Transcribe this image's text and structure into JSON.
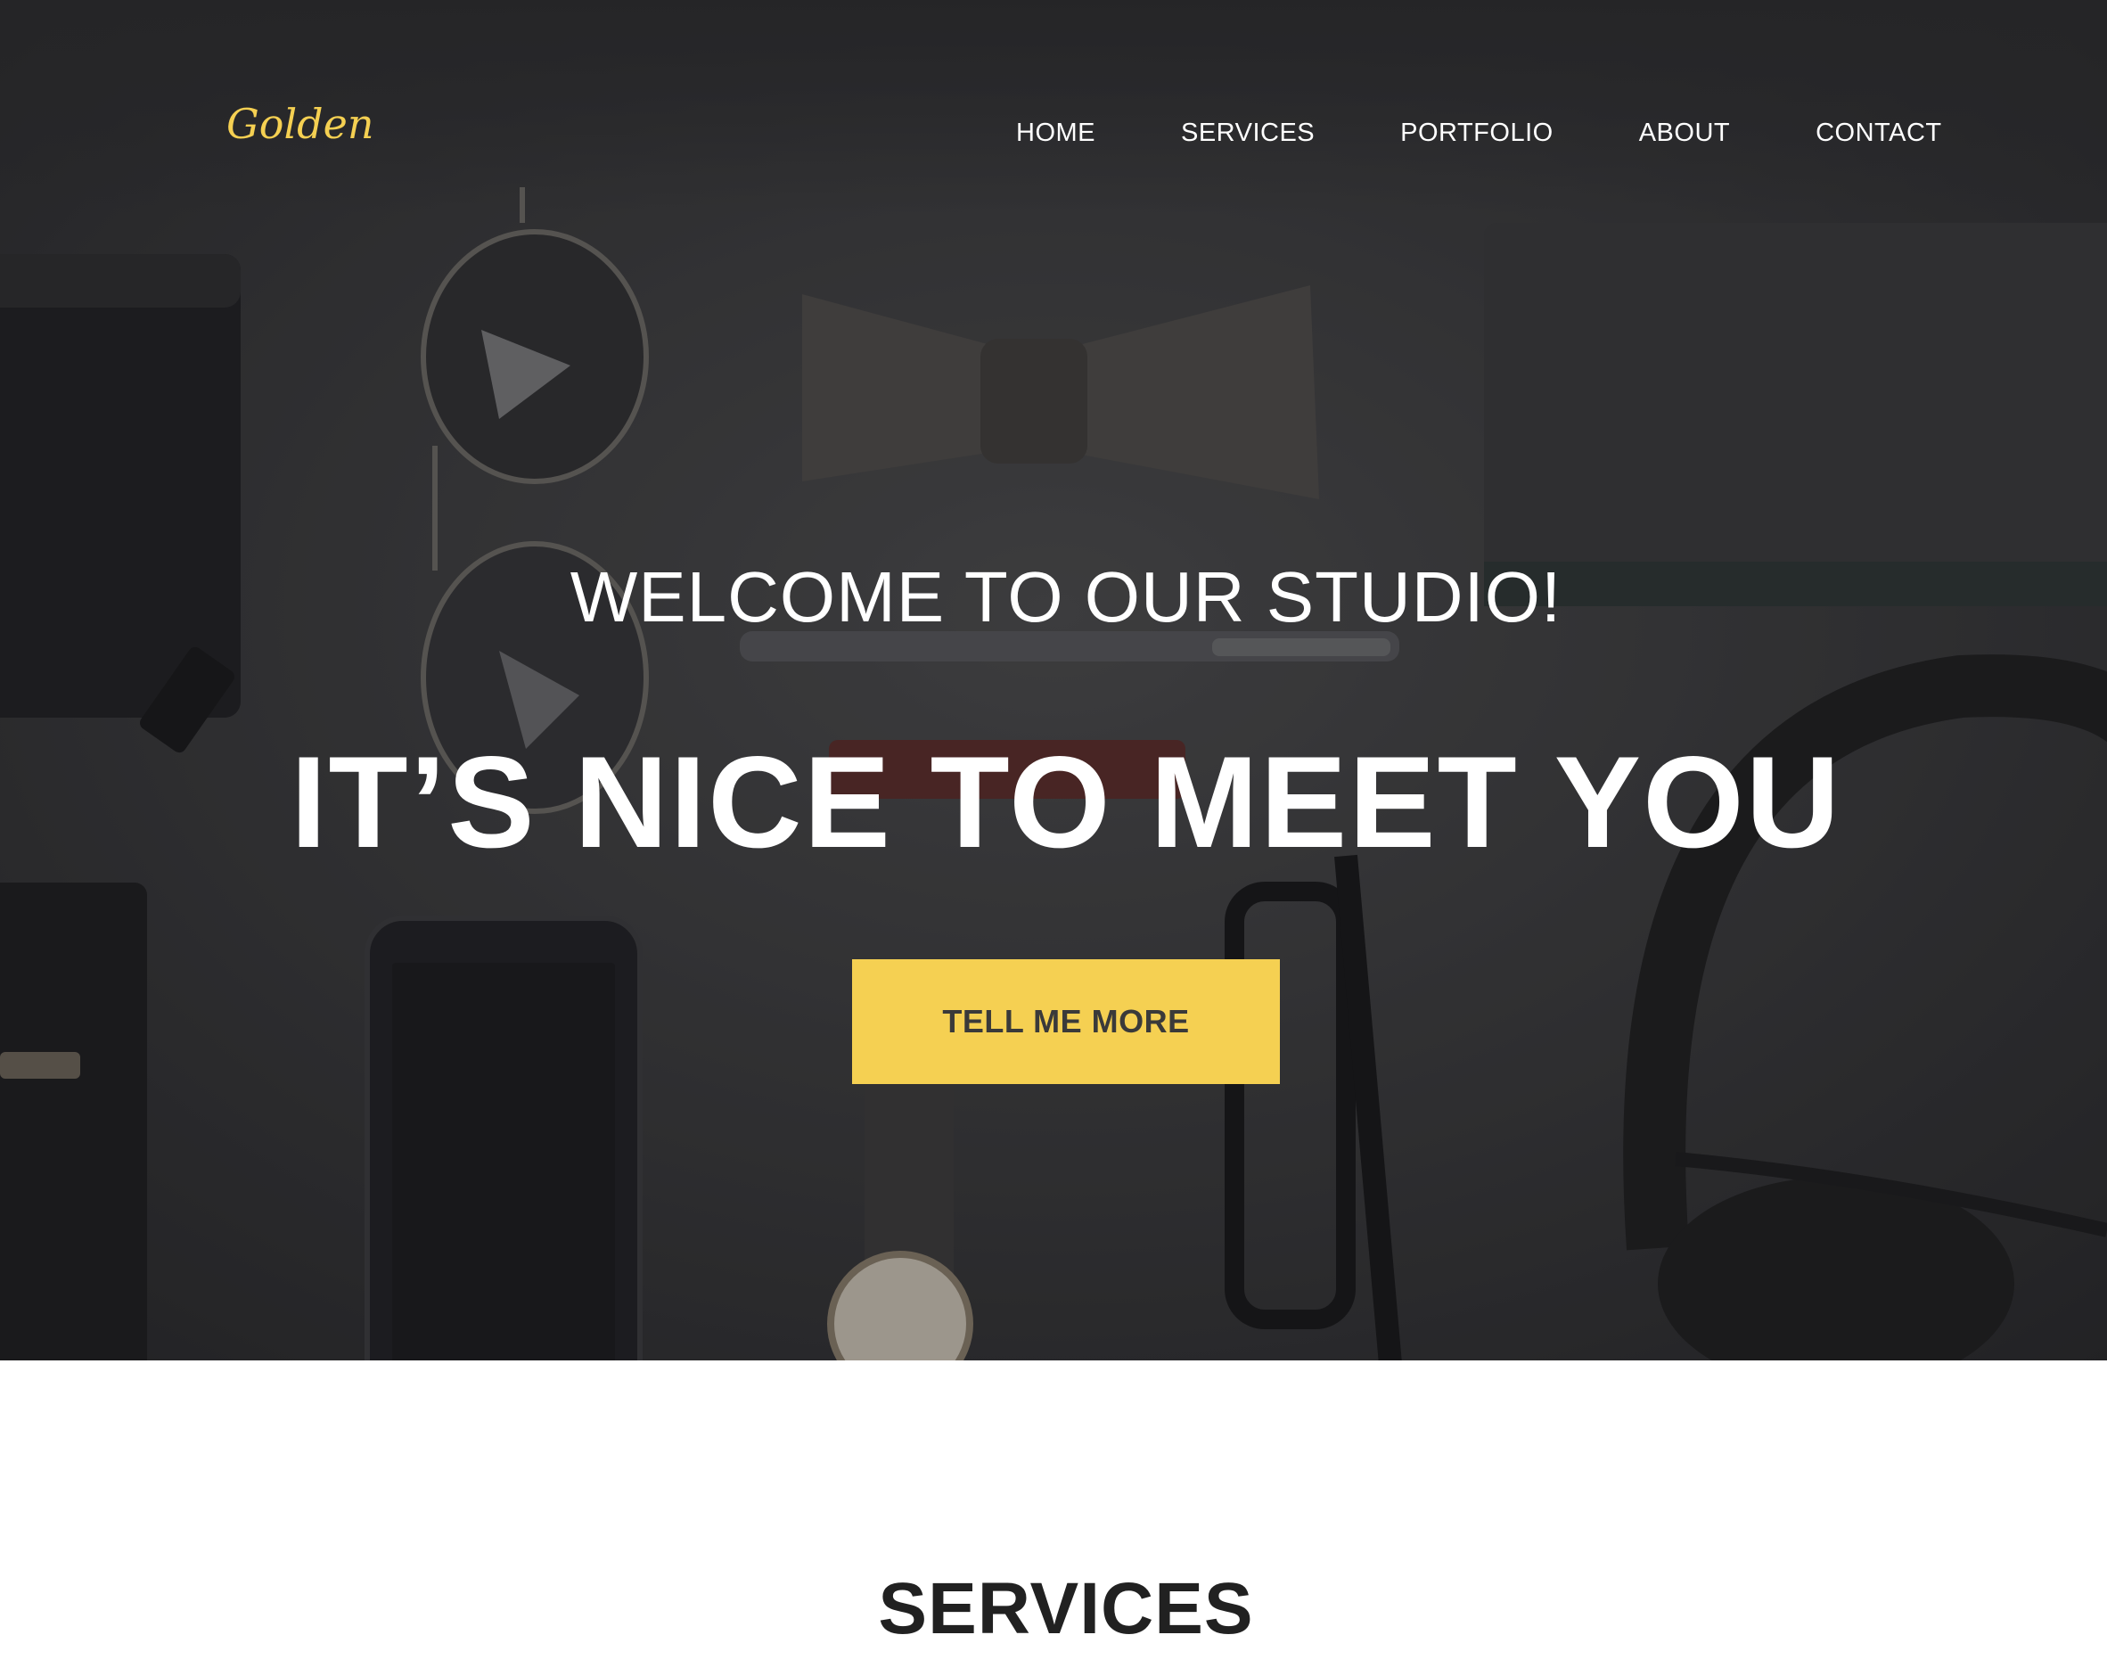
{
  "brand": {
    "logo_text": "Golden",
    "accent_color": "#f5d052"
  },
  "nav": {
    "items": [
      {
        "label": "HOME"
      },
      {
        "label": "SERVICES"
      },
      {
        "label": "PORTFOLIO"
      },
      {
        "label": "ABOUT"
      },
      {
        "label": "CONTACT"
      }
    ]
  },
  "hero": {
    "subtitle": "WELCOME TO OUR STUDIO!",
    "headline": "IT’S NICE TO MEET YOU",
    "cta_label": "TELL ME MORE",
    "background": "flat-lay photo of accessories: wallet, aviator sunglasses, bow tie, notebook, pen, pocket knife, smartphone, wristwatch, eyeglasses, headphones"
  },
  "services": {
    "title": "SERVICES"
  }
}
